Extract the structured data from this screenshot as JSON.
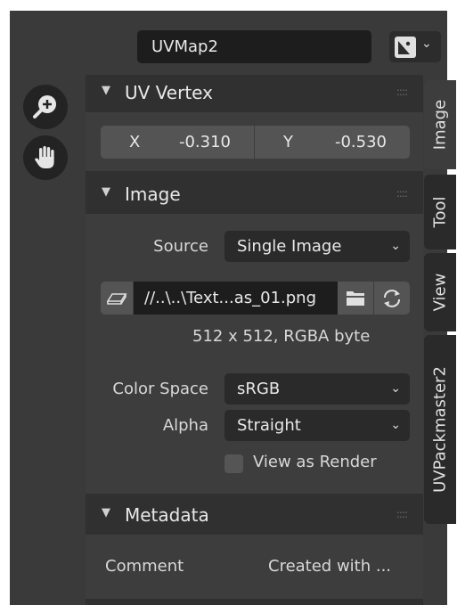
{
  "header": {
    "uv_map_name": "UVMap2",
    "image_type_icon": "image-icon"
  },
  "tools": {
    "zoom_icon": "zoom-in-icon",
    "pan_icon": "hand-icon"
  },
  "uv_vertex": {
    "title": "UV Vertex",
    "x_label": "X",
    "x_value": "-0.310",
    "y_label": "Y",
    "y_value": "-0.530"
  },
  "image": {
    "title": "Image",
    "source_label": "Source",
    "source_value": "Single Image",
    "file_path": "//..\\..\\Text...as_01.png",
    "resolution": "512 x 512,  RGBA byte",
    "color_space_label": "Color Space",
    "color_space_value": "sRGB",
    "alpha_label": "Alpha",
    "alpha_value": "Straight",
    "view_as_render_label": "View as Render"
  },
  "metadata": {
    "title": "Metadata",
    "comment_label": "Comment",
    "comment_value": "Created with ..."
  },
  "tabs": [
    "Image",
    "Tool",
    "View",
    "UVPackmaster2"
  ],
  "colors": {
    "panel_bg": "#3d3d3d",
    "header_bg": "#303030",
    "field_bg": "#545454"
  }
}
